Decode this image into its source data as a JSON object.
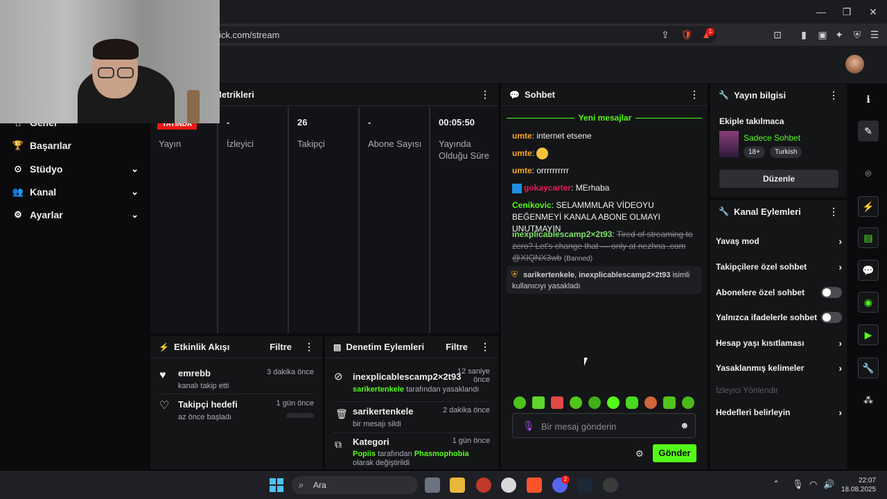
{
  "browser": {
    "url": "ick.com/stream",
    "brave_badge": "1",
    "window_controls": [
      "minimize-icon",
      "maximize-icon",
      "close-icon"
    ]
  },
  "sidebar": {
    "items": [
      {
        "label": "Genel",
        "icon": "home-icon"
      },
      {
        "label": "Başarılar",
        "icon": "trophy-icon"
      },
      {
        "label": "Stüdyo",
        "icon": "studio-icon"
      },
      {
        "label": "Kanal",
        "icon": "users-icon"
      },
      {
        "label": "Ayarlar",
        "icon": "gear-icon"
      }
    ]
  },
  "stats_panel": {
    "title": "Metrikleri",
    "columns": [
      {
        "value": "YAYINDA",
        "label": "Yayın"
      },
      {
        "value": "-",
        "label": "İzleyici"
      },
      {
        "value": "26",
        "label": "Takipçi"
      },
      {
        "value": "-",
        "label": "Abone Sayısı"
      },
      {
        "value": "00:05:50",
        "label": "Yayında Olduğu Süre"
      }
    ]
  },
  "activity_feed": {
    "title": "Etkinlik Akışı",
    "filter": "Filtre",
    "items": [
      {
        "title": "emrebb",
        "sub": "kanalı takip etti",
        "time": "3 dakika önce"
      },
      {
        "title": "Takipçi hedefi",
        "sub": "az önce başladı",
        "time": "1 gün önce",
        "progress": 0
      }
    ]
  },
  "moderation": {
    "title": "Denetim Eylemleri",
    "filter": "Filtre",
    "items": [
      {
        "title": "inexplicablescamp2×2t93",
        "actor": "sarikertenkele",
        "sub": "tarafından yasaklandı",
        "time": "12 saniye önce"
      },
      {
        "title": "sarikertenkele",
        "sub": "bir mesajı sildi",
        "time": "2 dakika önce"
      },
      {
        "title": "Kategori",
        "actor": "Popiis",
        "mid": "tarafından",
        "target": "Phasmophobia",
        "sub": "olarak değiştirildi",
        "time": "1 gün önce"
      }
    ]
  },
  "chat": {
    "title": "Sohbet",
    "new_messages": "Yeni mesajlar",
    "messages": [
      {
        "user": "umte",
        "text": "internet etsene",
        "color": "#f5a623"
      },
      {
        "user": "umte",
        "text": "",
        "color": "#f5a623"
      },
      {
        "user": "umte",
        "text": "orrrrrrrrrr",
        "color": "#f5a623"
      },
      {
        "user": "gokaycarter",
        "text": "MErhaba",
        "color": "#e9195a"
      },
      {
        "user": "Cenikovic",
        "text": "SELAMMMLAR VİDEOYU BEĞENMEYİ KANALA ABONE OLMAYI UNUTMAYIN",
        "color": "#53fc18"
      },
      {
        "user": "inexplicablescamp2×2t93",
        "text": "Tired of streaming to zero? Let's change that — only at nezhna .com @XIQNX3wb",
        "color": "#7ee06a",
        "tag": "(Banned)"
      }
    ],
    "system": {
      "actor": "sarikertenkele",
      "sep": ", ",
      "target": "inexplicablescamp2×2t93",
      "text": "isimli kullanıcıyı yasakladı"
    },
    "placeholder": "Bir mesaj gönderin",
    "send": "Gönder"
  },
  "stream_info": {
    "title": "Yayın bilgisi",
    "stream_title": "Ekiple takılmaca",
    "category": "Sadece Sohbet",
    "tags": [
      "18+",
      "Turkish"
    ],
    "edit": "Düzenle"
  },
  "channel_actions": {
    "title": "Kanal Eylemleri",
    "rows": [
      {
        "label": "Yavaş mod",
        "kind": "chevron"
      },
      {
        "label": "Takipçilere özel sohbet",
        "kind": "chevron"
      },
      {
        "label": "Abonelere özel sohbet",
        "kind": "toggle"
      },
      {
        "label": "Yalnızca ifadelerle sohbet",
        "kind": "toggle"
      },
      {
        "label": "Hesap yaşı kısıtlaması",
        "kind": "chevron"
      },
      {
        "label": "Yasaklanmış kelimeler",
        "kind": "chevron"
      },
      {
        "label": "İzleyici Yönlendir",
        "kind": "disabled"
      },
      {
        "label": "Hedefleri belirleyin",
        "kind": "chevron"
      }
    ]
  },
  "taskbar": {
    "search": "Ara",
    "time": "22:07",
    "date": "18.08.2025",
    "discord_badge": "2"
  },
  "colors": {
    "accent": "#53fc18",
    "live": "#e91916",
    "panel": "#141517"
  }
}
